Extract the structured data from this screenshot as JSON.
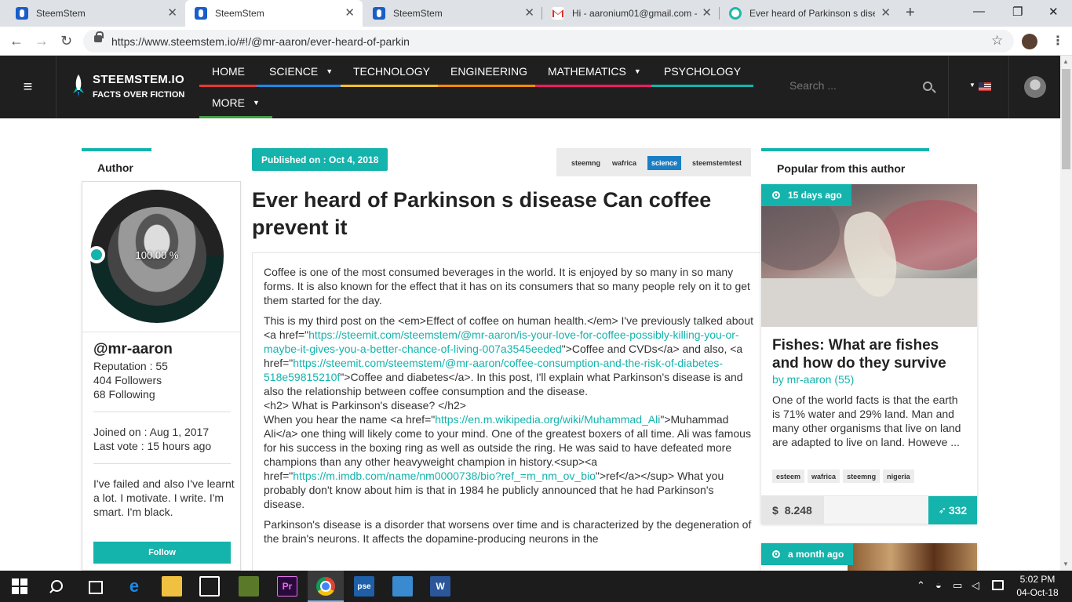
{
  "browser": {
    "tabs": [
      {
        "title": "SteemStem",
        "icon": "steemstem-icon",
        "active": false
      },
      {
        "title": "SteemStem",
        "icon": "steemstem-icon",
        "active": true
      },
      {
        "title": "SteemStem",
        "icon": "steemstem-icon",
        "active": false
      },
      {
        "title": "Hi - aaronium01@gmail.com -",
        "icon": "gmail-icon",
        "active": false
      },
      {
        "title": "Ever heard of Parkinson s disea",
        "icon": "site-icon",
        "active": false
      }
    ],
    "url": "https://www.steemstem.io/#!/@mr-aaron/ever-heard-of-parkin"
  },
  "site": {
    "logo_line1": "STEEMSTEM.IO",
    "logo_line2": "FACTS OVER FICTION",
    "nav": [
      {
        "label": "HOME",
        "color": "#e53935",
        "dropdown": false
      },
      {
        "label": "SCIENCE",
        "color": "#1e88e5",
        "dropdown": true
      },
      {
        "label": "TECHNOLOGY",
        "color": "#fbc02d",
        "dropdown": false
      },
      {
        "label": "ENGINEERING",
        "color": "#fb8c00",
        "dropdown": false
      },
      {
        "label": "MATHEMATICS",
        "color": "#e91e63",
        "dropdown": true
      },
      {
        "label": "PSYCHOLOGY",
        "color": "#14b3ac",
        "dropdown": false
      },
      {
        "label": "MORE",
        "color": "#43a047",
        "dropdown": true
      }
    ],
    "search_placeholder": "Search ...",
    "accent": "#14b3ac"
  },
  "author": {
    "section_title": "Author",
    "ring_label": "100.00 %",
    "name": "@mr-aaron",
    "reputation": "Reputation : 55",
    "followers": "404 Followers",
    "following": "68 Following",
    "joined": "Joined on : Aug 1, 2017",
    "last_vote": "Last vote : 15 hours ago",
    "bio": "I've failed and also I've learnt a lot. I motivate. I write. I'm smart. I'm black.",
    "follow_label": "Follow"
  },
  "article": {
    "published": "Published on : Oct 4, 2018",
    "tags": [
      {
        "label": "steemng",
        "active": false
      },
      {
        "label": "wafrica",
        "active": false
      },
      {
        "label": "science",
        "active": true
      },
      {
        "label": "steemstemtest",
        "active": false
      }
    ],
    "title": "Ever heard of Parkinson s disease Can coffee prevent it",
    "p1": "Coffee is one of the most consumed beverages in the world. It is enjoyed by so many in so many forms. It is also known for the effect that it has on its consumers that so many people rely on it to get them started for the day.",
    "p2_a": "This is my third post on the <em>Effect of coffee on human health.</em> I've previously talked about <a href=\"",
    "p2_link1": "https://steemit.com/steemstem/@mr-aaron/is-your-love-for-coffee-possibly-killing-you-or-maybe-it-gives-you-a-better-chance-of-living-007a3545eeded",
    "p2_b": "\">Coffee and CVDs</a> and also, <a href=\"",
    "p2_link2": "https://steemit.com/steemstem/@mr-aaron/coffee-consumption-and-the-risk-of-diabetes-518e59815210f",
    "p2_c": "\">Coffee and diabetes</a>. In this post, I'll explain what Parkinson's disease is and also the relationship between coffee consumption and the disease.",
    "h2": "<h2> What is Parkinson's disease? </h2>",
    "p3_a": "When you hear the name <a href=\"",
    "p3_link1": "https://en.m.wikipedia.org/wiki/Muhammad_Ali",
    "p3_b": "\">Muhammad Ali</a> one thing will likely come to your mind. One of the greatest boxers of all time. Ali was famous for his success in the boxing ring as well as outside the ring. He was said to have defeated more champions than any other heavyweight champion in history.<sup><a href=\"",
    "p3_link2": "https://m.imdb.com/name/nm0000738/bio?ref_=m_nm_ov_bio",
    "p3_c": "\">ref</a></sup> What you probably don't know about him is that in 1984 he publicly announced that he had Parkinson's disease.",
    "p4": "Parkinson's disease is a disorder that worsens over time and is characterized by the degeneration of the brain's neurons. It affects the dopamine-producing neurons in the"
  },
  "popular": {
    "section_title": "Popular from this author",
    "card1": {
      "time": "15 days ago",
      "title": "Fishes: What are fishes and how do they survive",
      "by": "by mr-aaron (55)",
      "excerpt": "One of the world facts is that the earth is 71% water and 29% land. Man and many other organisms that live on land are adapted to live on land. Howeve ...",
      "tags": [
        "esteem",
        "wafrica",
        "steemng",
        "nigeria"
      ],
      "payout": "8.248",
      "payout_symbol": "$",
      "votes": "332"
    },
    "card2": {
      "time": "a month ago"
    }
  },
  "taskbar": {
    "time": "5:02 PM",
    "date": "04-Oct-18",
    "apps": [
      "edge-icon",
      "file-explorer-icon",
      "store-icon",
      "excel-like-icon",
      "premiere-icon",
      "chrome-icon",
      "photoshop-icon",
      "app-icon",
      "word-icon"
    ]
  }
}
